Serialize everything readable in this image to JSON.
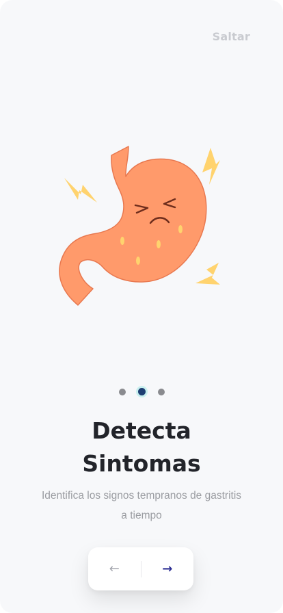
{
  "header": {
    "skip_label": "Saltar"
  },
  "illustration": {
    "subject": "stomach-in-pain-icon"
  },
  "pagination": {
    "total": 3,
    "active_index": 1
  },
  "content": {
    "title_line1": "Detecta",
    "title_line2": "Sintomas",
    "subtitle": "Identifica los signos tempranos de gastritis a tiempo"
  },
  "nav": {
    "prev_icon": "arrow-left-icon",
    "prev_glyph": "←",
    "next_icon": "arrow-right-icon",
    "next_glyph": "→"
  },
  "colors": {
    "background": "#f7f8fa",
    "stomach": "#ff9a6b",
    "stomach_outline": "#e8784f",
    "lightning": "#ffd36e",
    "active_dot": "#1e3f73",
    "active_dot_ring": "#c9f0ef",
    "next_arrow": "#2d2f93"
  }
}
